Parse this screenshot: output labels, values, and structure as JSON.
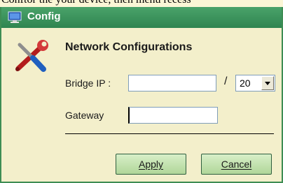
{
  "top_caption": "Conftor the your device, then menu recess",
  "window": {
    "title": "Config"
  },
  "form": {
    "heading": "Network Configurations",
    "bridge_ip_label": "Bridge IP :",
    "bridge_ip_value": "",
    "separator": "/",
    "mask_value": "20",
    "gateway_label": "Gateway",
    "gateway_value": ""
  },
  "buttons": {
    "apply": "Apply",
    "cancel": "Cancel"
  },
  "icons": {
    "title_icon": "computer-icon",
    "tools_icon": "tools-icon",
    "dropdown_icon": "chevron-down-icon"
  },
  "colors": {
    "titlebar": "#3a9a5e",
    "window_bg": "#f3efcb",
    "button": "#c2e3ad"
  }
}
